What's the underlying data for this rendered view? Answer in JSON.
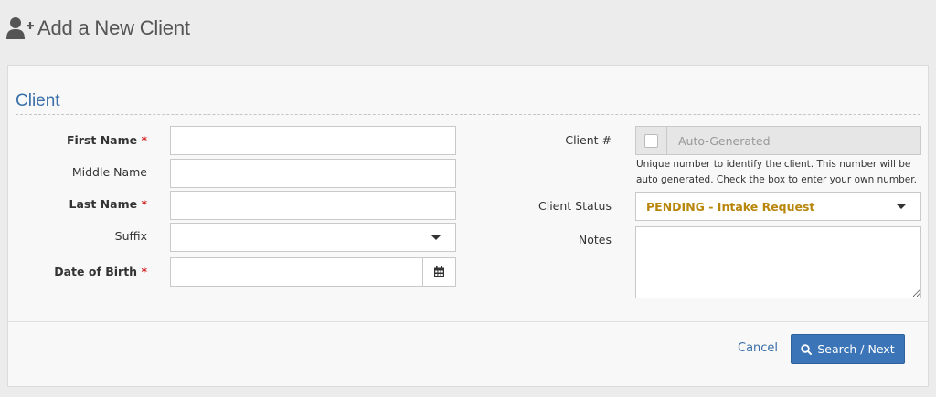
{
  "header": {
    "title": "Add a New Client",
    "icon": "add-user-icon"
  },
  "section": {
    "title": "Client"
  },
  "left_fields": {
    "first_name": {
      "label": "First Name",
      "required_mark": "*",
      "value": ""
    },
    "middle_name": {
      "label": "Middle Name",
      "value": ""
    },
    "last_name": {
      "label": "Last Name",
      "required_mark": "*",
      "value": ""
    },
    "suffix": {
      "label": "Suffix",
      "value": ""
    },
    "dob": {
      "label": "Date of Birth",
      "required_mark": "*",
      "value": "",
      "icon": "calendar-icon"
    }
  },
  "right_fields": {
    "client_number": {
      "label": "Client #",
      "placeholder": "Auto-Generated",
      "checked": false,
      "help": "Unique number to identify the client. This number will be auto generated. Check the box to enter your own number."
    },
    "client_status": {
      "label": "Client Status",
      "value": "PENDING - Intake Request",
      "value_color": "#b8860b"
    },
    "notes": {
      "label": "Notes",
      "value": ""
    }
  },
  "footer": {
    "cancel_label": "Cancel",
    "submit_label": "Search / Next",
    "submit_icon": "search-icon",
    "accent": "#3b75b7"
  }
}
